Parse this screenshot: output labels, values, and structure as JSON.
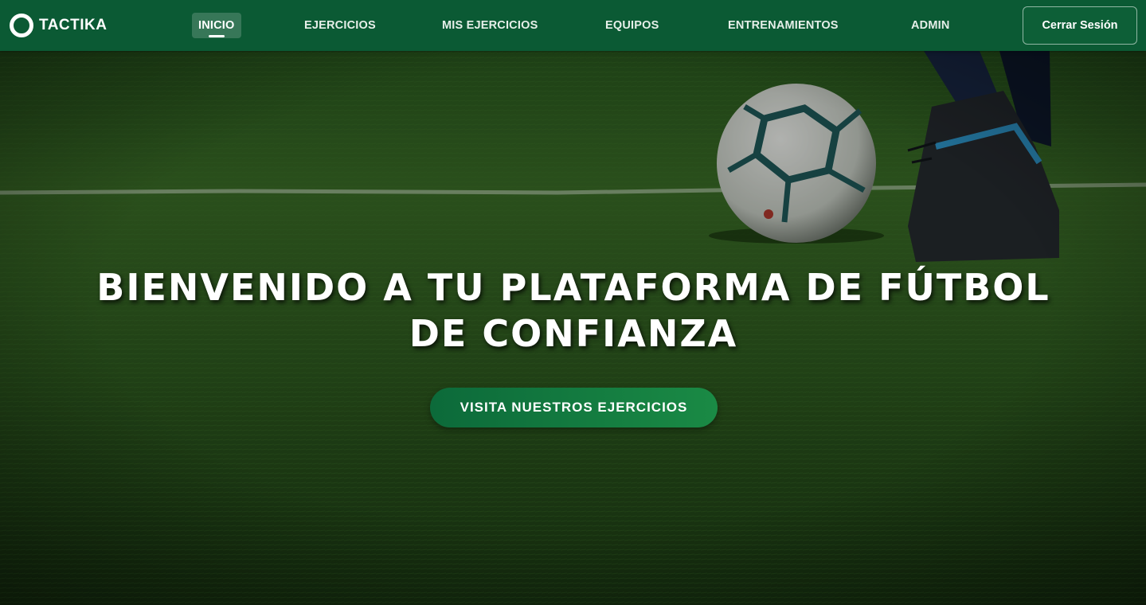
{
  "brand": {
    "name": "TACTIKA",
    "icon": "ring-logo-icon"
  },
  "nav": {
    "items": [
      {
        "label": "INICIO",
        "active": true
      },
      {
        "label": "EJERCICIOS",
        "active": false
      },
      {
        "label": "MIS EJERCICIOS",
        "active": false
      },
      {
        "label": "EQUIPOS",
        "active": false
      },
      {
        "label": "ENTRENAMIENTOS",
        "active": false
      },
      {
        "label": "ADMIN",
        "active": false
      }
    ],
    "logout_label": "Cerrar Sesión"
  },
  "hero": {
    "title": "BIENVENIDO A TU PLATAFORMA DE FÚTBOL DE CONFIANZA",
    "cta_label": "VISITA NUESTROS EJERCICIOS",
    "background": "soccer-field-with-ball-and-player-photo"
  },
  "colors": {
    "navbar": "#0b5a34",
    "accent": "#1a8a45",
    "text": "#ffffff"
  }
}
